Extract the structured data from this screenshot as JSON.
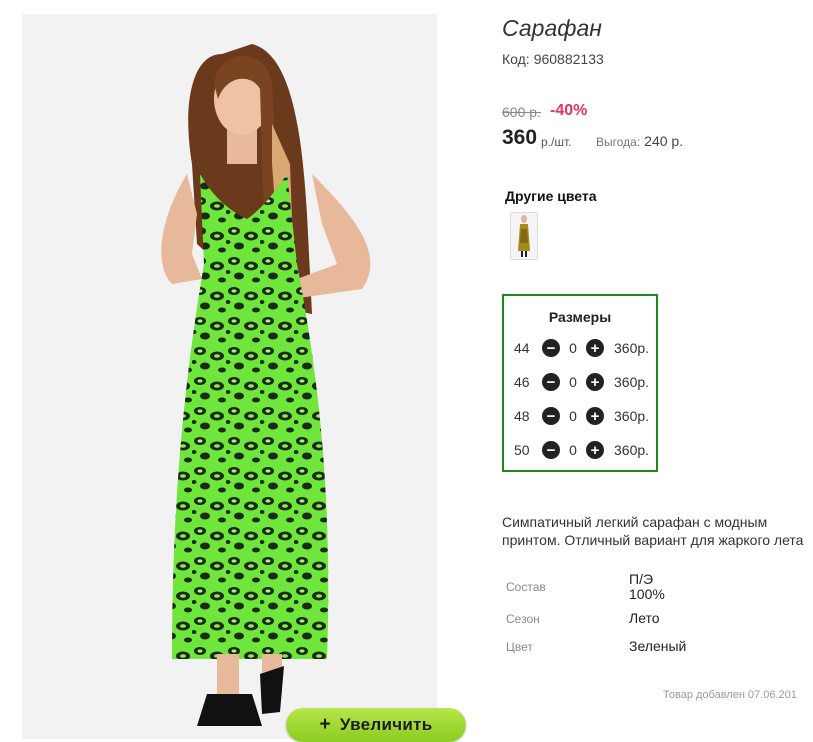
{
  "product": {
    "title": "Сарафан",
    "code_label": "Код:",
    "code_value": "960882133",
    "old_price": "600 р.",
    "discount": "-40%",
    "price": "360",
    "price_unit": "р./шт.",
    "savings_label": "Выгода:",
    "savings_value": "240 р."
  },
  "other_colors": {
    "title": "Другие цвета"
  },
  "sizes": {
    "title": "Размеры",
    "minus_icon": "minus-circle-icon",
    "plus_icon": "plus-circle-icon",
    "minus_glyph": "−",
    "plus_glyph": "+",
    "rows": [
      {
        "size": "44",
        "qty": "0",
        "price": "360р."
      },
      {
        "size": "46",
        "qty": "0",
        "price": "360р."
      },
      {
        "size": "48",
        "qty": "0",
        "price": "360р."
      },
      {
        "size": "50",
        "qty": "0",
        "price": "360р."
      }
    ]
  },
  "description": "Симпатичный легкий сарафан с модным принтом. Отличный вариант для жаркого лета",
  "attributes": [
    {
      "label": "Состав",
      "value_line1": "П/Э",
      "value_line2": "100%"
    },
    {
      "label": "Сезон",
      "value_line1": "Лето"
    },
    {
      "label": "Цвет",
      "value_line1": "Зеленый"
    }
  ],
  "added": {
    "label": "Товар добавлен",
    "date": "07.06.201"
  },
  "zoom_button": {
    "icon_glyph": "+",
    "label": "Увеличить"
  },
  "colors": {
    "accent_green": "#1a8a1a",
    "discount_red": "#e2345a",
    "zoom_button": "#a5dc35",
    "dress_green": "#6ee83a"
  }
}
